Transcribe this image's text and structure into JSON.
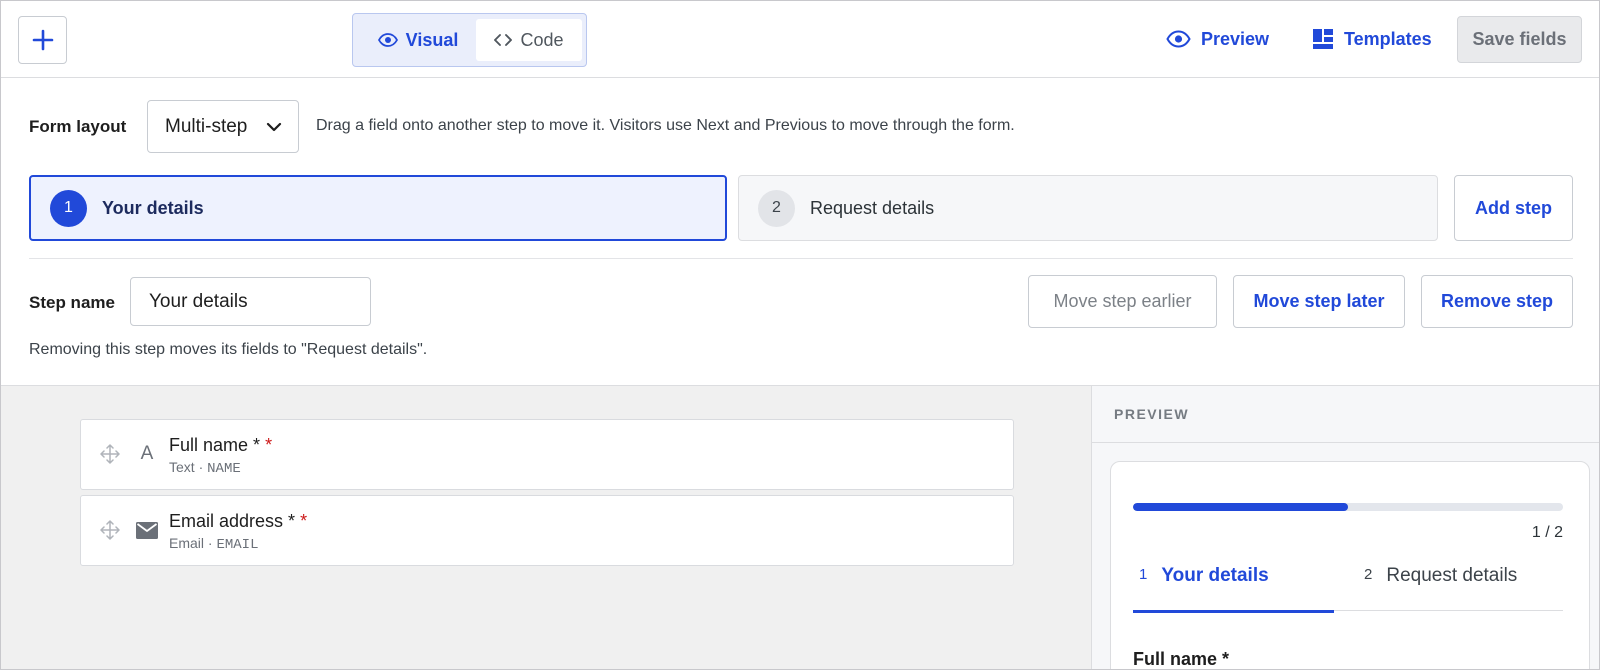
{
  "toolbar": {
    "add_icon": "plus-icon",
    "view_toggle": {
      "visual_label": "Visual",
      "code_label": "Code",
      "selected": "Visual"
    },
    "preview_label": "Preview",
    "templates_label": "Templates",
    "save_label": "Save fields"
  },
  "settings": {
    "layout_label": "Form layout",
    "layout_value": "Multi-step",
    "layout_hint": "Drag a field onto another step to move it. Visitors use Next and Previous to move through the form.",
    "steps": [
      {
        "number": "1",
        "name": "Your details",
        "selected": true
      },
      {
        "number": "2",
        "name": "Request details",
        "selected": false
      }
    ],
    "add_step_label": "Add step",
    "step_name_label": "Step name",
    "step_name_value": "Your details",
    "move_earlier_label": "Move step earlier",
    "move_later_label": "Move step later",
    "remove_step_label": "Remove step",
    "remove_note": "Removing this step moves its fields to \"Request details\"."
  },
  "fields": [
    {
      "title": "Full name *",
      "required_mark": "*",
      "type": "Text",
      "sep": "·",
      "key": "NAME",
      "icon": "text-type-icon",
      "icon_glyph": "A"
    },
    {
      "title": "Email address *",
      "required_mark": "*",
      "type": "Email",
      "sep": "·",
      "key": "EMAIL",
      "icon": "envelope-icon"
    }
  ],
  "preview": {
    "heading": "PREVIEW",
    "progress": 0.5,
    "progress_text": "1 / 2",
    "tabs": [
      {
        "number": "1",
        "label": "Your details",
        "active": true
      },
      {
        "number": "2",
        "label": "Request details",
        "active": false
      }
    ],
    "first_field_label": "Full name *"
  },
  "colors": {
    "accent": "#2149d9",
    "required": "#cc1818"
  }
}
